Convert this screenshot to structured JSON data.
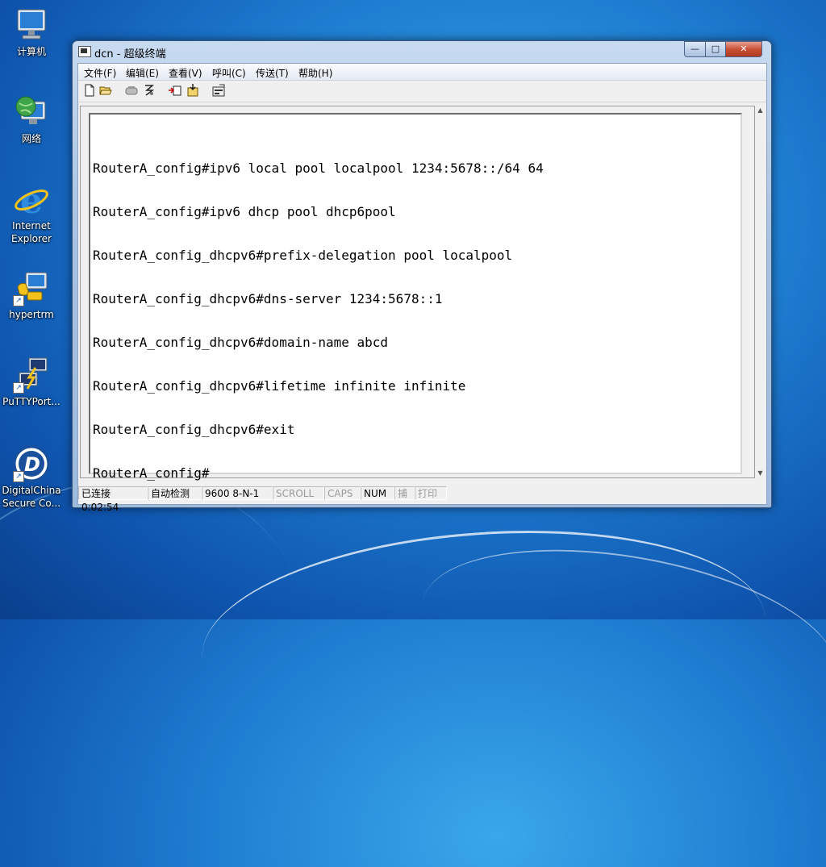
{
  "desktop": {
    "icons": [
      {
        "label": "计算机"
      },
      {
        "label": "网络"
      },
      {
        "label": "Internet Explorer"
      },
      {
        "label": "hypertrm"
      },
      {
        "label": "PuTTYPort..."
      },
      {
        "label": "DigitalChina Secure Co..."
      }
    ]
  },
  "window": {
    "title": "dcn - 超级终端",
    "controls": {
      "minimize": "—",
      "maximize": "□",
      "close": "✕"
    }
  },
  "menu": {
    "items": [
      "文件(F)",
      "编辑(E)",
      "查看(V)",
      "呼叫(C)",
      "传送(T)",
      "帮助(H)"
    ]
  },
  "toolbar": {
    "icons": [
      "new-icon",
      "open-icon",
      "disconnect-icon",
      "dial-icon",
      "send-icon",
      "receive-icon",
      "properties-icon"
    ]
  },
  "terminal": {
    "lines": [
      "RouterA_config#ipv6 local pool localpool 1234:5678::/64 64",
      "RouterA_config#ipv6 dhcp pool dhcp6pool",
      "RouterA_config_dhcpv6#prefix-delegation pool localpool",
      "RouterA_config_dhcpv6#dns-server 1234:5678::1",
      "RouterA_config_dhcpv6#domain-name abcd",
      "RouterA_config_dhcpv6#lifetime infinite infinite",
      "RouterA_config_dhcpv6#exit",
      "RouterA_config#"
    ]
  },
  "status": {
    "connection": "已连接 0:02:54",
    "detect": "自动检测",
    "port": "9600 8-N-1",
    "scroll": "SCROLL",
    "caps": "CAPS",
    "num": "NUM",
    "capture": "捕",
    "print": "打印"
  },
  "colors": {
    "terminal_bg": "#ffffff",
    "terminal_text": "#000000",
    "desktop_blue": "#1f7fd2"
  }
}
